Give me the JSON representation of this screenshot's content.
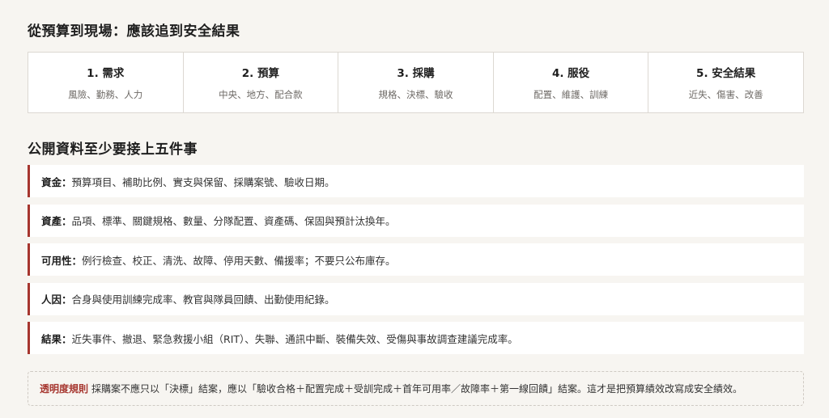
{
  "section1": {
    "title": "從預算到現場：應該追到安全結果",
    "steps": [
      {
        "title": "1. 需求",
        "sub": "風險、勤務、人力"
      },
      {
        "title": "2. 預算",
        "sub": "中央、地方、配合款"
      },
      {
        "title": "3. 採購",
        "sub": "規格、決標、驗收"
      },
      {
        "title": "4. 服役",
        "sub": "配置、維護、訓練"
      },
      {
        "title": "5. 安全結果",
        "sub": "近失、傷害、改善"
      }
    ]
  },
  "section2": {
    "title": "公開資料至少要接上五件事",
    "separator": "：",
    "items": [
      {
        "label": "資金",
        "text": "預算項目、補助比例、實支與保留、採購案號、驗收日期。"
      },
      {
        "label": "資產",
        "text": "品項、標準、關鍵規格、數量、分隊配置、資產碼、保固與預計汰換年。"
      },
      {
        "label": "可用性",
        "text": "例行檢查、校正、清洗、故障、停用天數、備援率；不要只公布庫存。"
      },
      {
        "label": "人因",
        "text": "合身與使用訓練完成率、教官與隊員回饋、出勤使用紀錄。"
      },
      {
        "label": "結果",
        "text": "近失事件、撤退、緊急救援小組（RIT）、失聯、通訊中斷、裝備失效、受傷與事故調查建議完成率。"
      }
    ]
  },
  "rule": {
    "label": "透明度規則",
    "text": "採購案不應只以「決標」結案，應以「驗收合格＋配置完成＋受訓完成＋首年可用率／故障率＋第一線回饋」結案。這才是把預算績效改寫成安全績效。"
  },
  "colors": {
    "accent": "#a6362f",
    "background": "#f7f5f1",
    "card": "#ffffff",
    "border": "#dcd8d2"
  }
}
